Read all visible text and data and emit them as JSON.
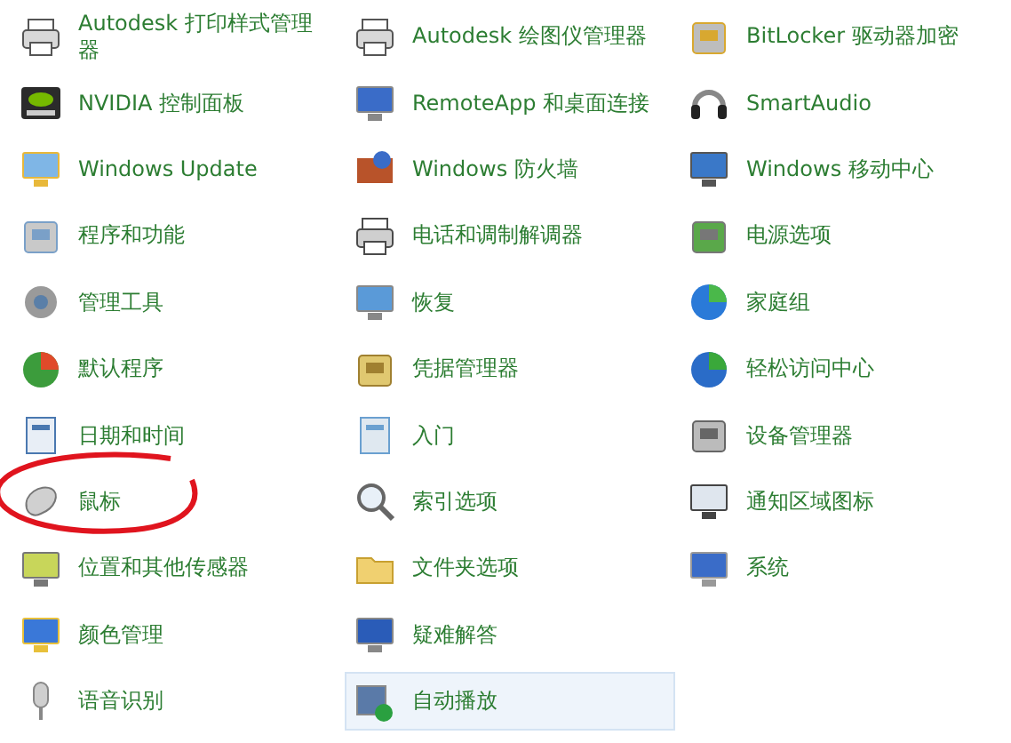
{
  "items": [
    {
      "label": "Autodesk 打印样式管理器",
      "kind": "printer",
      "selected": false
    },
    {
      "label": "NVIDIA 控制面板",
      "kind": "nvidia",
      "selected": false
    },
    {
      "label": "Windows Update",
      "kind": "update",
      "selected": false
    },
    {
      "label": "程序和功能",
      "kind": "programs",
      "selected": false
    },
    {
      "label": "管理工具",
      "kind": "tools",
      "selected": false
    },
    {
      "label": "默认程序",
      "kind": "default",
      "selected": false
    },
    {
      "label": "日期和时间",
      "kind": "clock",
      "selected": false
    },
    {
      "label": "鼠标",
      "kind": "mouse",
      "selected": false
    },
    {
      "label": "位置和其他传感器",
      "kind": "sensor",
      "selected": false
    },
    {
      "label": "颜色管理",
      "kind": "color",
      "selected": false
    },
    {
      "label": "语音识别",
      "kind": "mic",
      "selected": false
    },
    {
      "label": "Autodesk 绘图仪管理器",
      "kind": "printer",
      "selected": false
    },
    {
      "label": "RemoteApp 和桌面连接",
      "kind": "remote",
      "selected": false
    },
    {
      "label": "Windows 防火墙",
      "kind": "firewall",
      "selected": false
    },
    {
      "label": "电话和调制解调器",
      "kind": "phone",
      "selected": false
    },
    {
      "label": "恢复",
      "kind": "recovery",
      "selected": false
    },
    {
      "label": "凭据管理器",
      "kind": "vault",
      "selected": false
    },
    {
      "label": "入门",
      "kind": "start",
      "selected": false
    },
    {
      "label": "索引选项",
      "kind": "search",
      "selected": false
    },
    {
      "label": "文件夹选项",
      "kind": "folder",
      "selected": false
    },
    {
      "label": "疑难解答",
      "kind": "trouble",
      "selected": false
    },
    {
      "label": "自动播放",
      "kind": "autoplay",
      "selected": true
    },
    {
      "label": "BitLocker 驱动器加密",
      "kind": "bitlocker",
      "selected": false
    },
    {
      "label": "SmartAudio",
      "kind": "audio",
      "selected": false
    },
    {
      "label": "Windows 移动中心",
      "kind": "mobility",
      "selected": false
    },
    {
      "label": "电源选项",
      "kind": "power",
      "selected": false
    },
    {
      "label": "家庭组",
      "kind": "homegroup",
      "selected": false
    },
    {
      "label": "轻松访问中心",
      "kind": "access",
      "selected": false
    },
    {
      "label": "设备管理器",
      "kind": "device",
      "selected": false
    },
    {
      "label": "通知区域图标",
      "kind": "tray",
      "selected": false
    },
    {
      "label": "系统",
      "kind": "system",
      "selected": false
    }
  ]
}
